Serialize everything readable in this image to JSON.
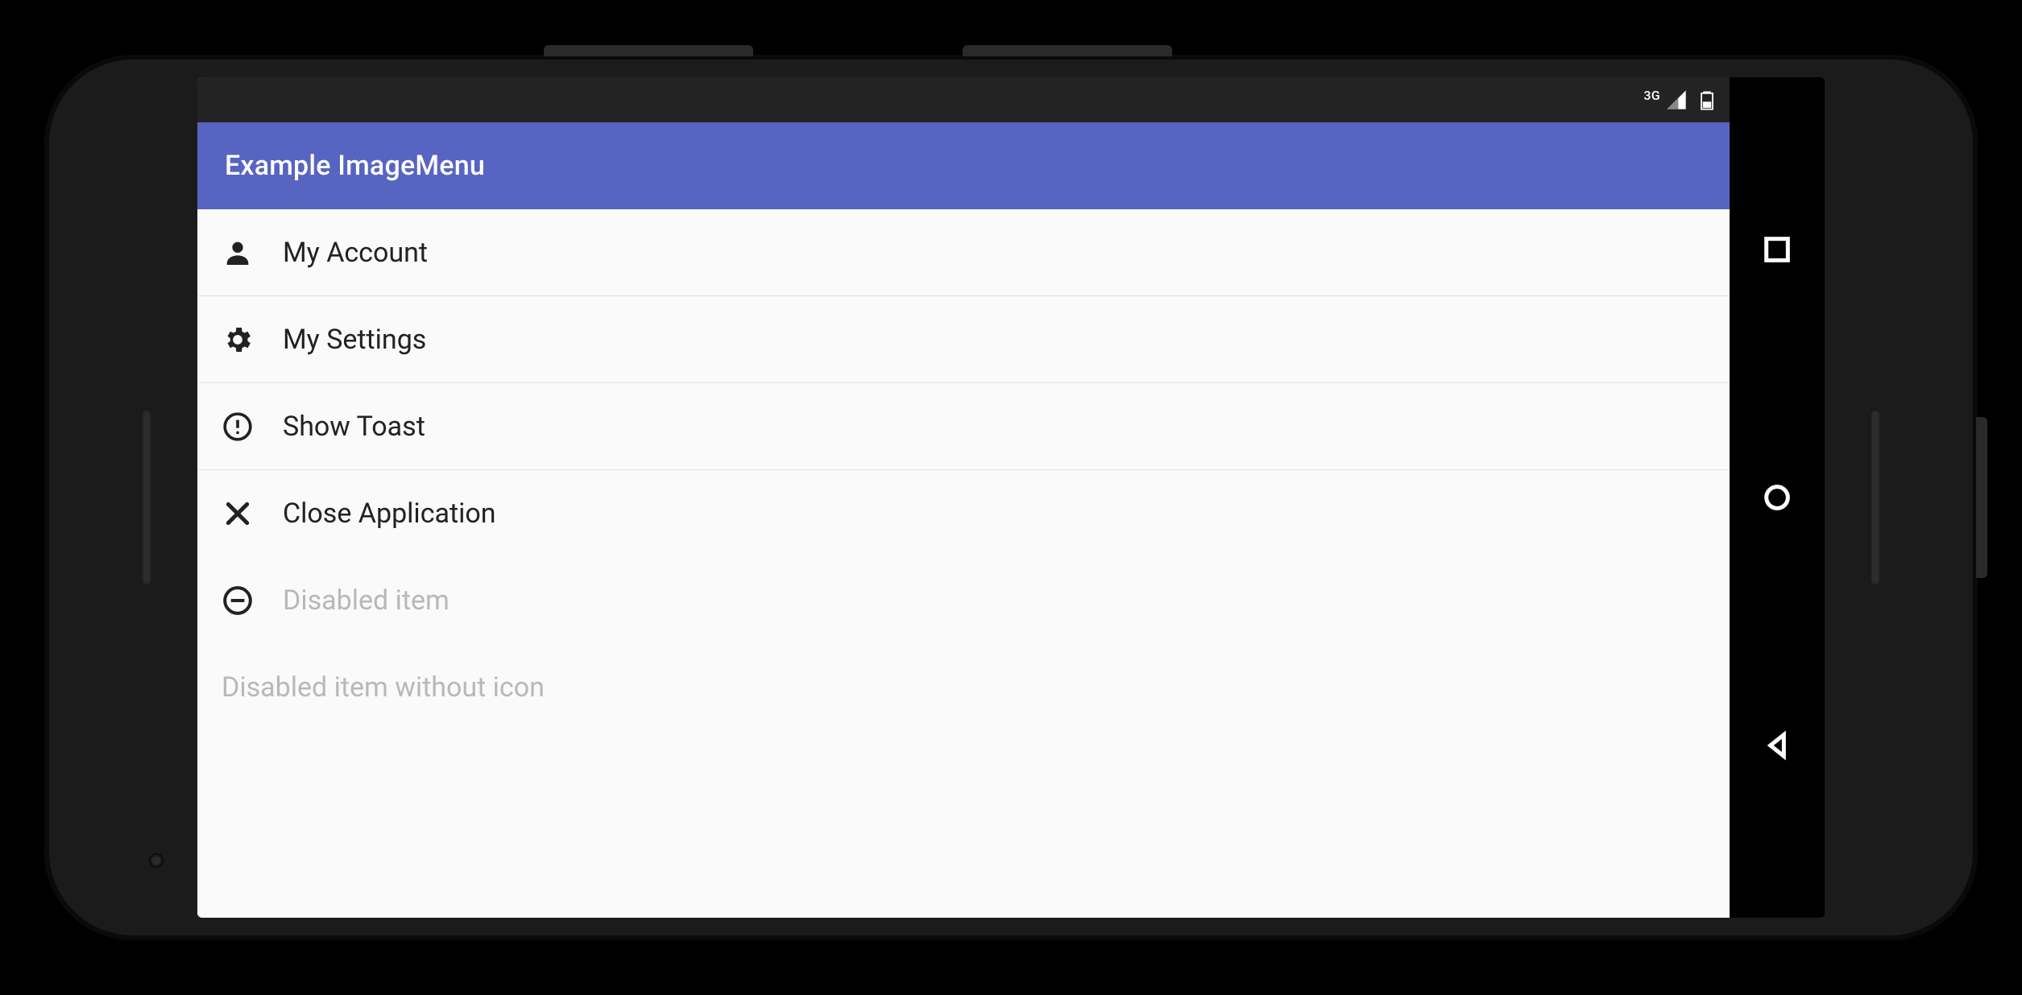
{
  "status": {
    "network_label": "3G"
  },
  "appbar": {
    "title": "Example ImageMenu"
  },
  "menu": {
    "items": [
      {
        "icon": "person",
        "label": "My Account",
        "enabled": true
      },
      {
        "icon": "gear",
        "label": "My Settings",
        "enabled": true
      },
      {
        "icon": "alert-circle",
        "label": "Show Toast",
        "enabled": true
      },
      {
        "icon": "close",
        "label": "Close Application",
        "enabled": true
      },
      {
        "icon": "minus-circle",
        "label": "Disabled item",
        "enabled": false
      },
      {
        "icon": null,
        "label": "Disabled item without icon",
        "enabled": false
      }
    ]
  }
}
